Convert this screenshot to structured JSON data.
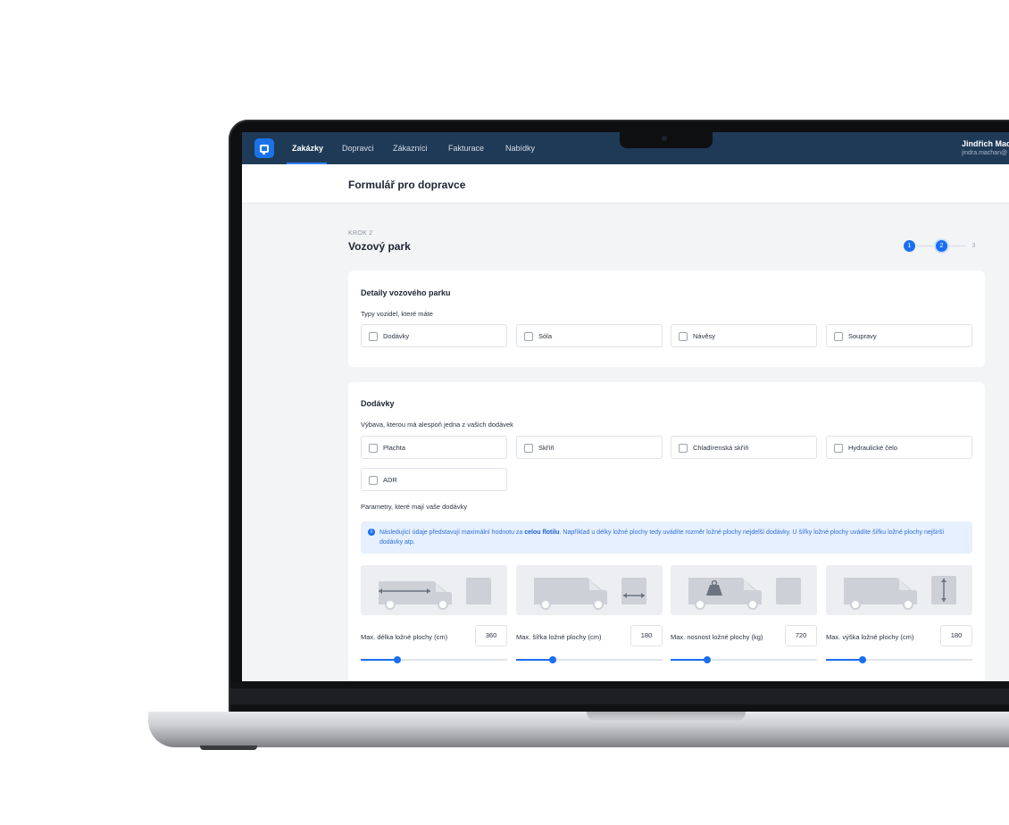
{
  "nav": {
    "items": [
      {
        "label": "Zakázky",
        "active": true
      },
      {
        "label": "Dopravci"
      },
      {
        "label": "Zákazníci"
      },
      {
        "label": "Fakturace"
      },
      {
        "label": "Nabídky"
      }
    ]
  },
  "user": {
    "name": "Jindřich Mach",
    "email": "jindra.machan@"
  },
  "page": {
    "title": "Formulář pro dopravce"
  },
  "step": {
    "kicker": "KROK 2",
    "title": "Vozový park",
    "steps": [
      "1",
      "2",
      "3"
    ],
    "current": 2
  },
  "fleet": {
    "title": "Detaily vozového parku",
    "types_label": "Typy vozidel, které máte",
    "types": [
      "Dodávky",
      "Sóla",
      "Návěsy",
      "Soupravy"
    ]
  },
  "vans": {
    "title": "Dodávky",
    "equipment_label": "Výbava, kterou má alespoň jedna z vašich dodávek",
    "equipment": [
      "Plachta",
      "Skříň",
      "Chladírenská skříň",
      "Hydraulické čelo",
      "ADR"
    ],
    "params_label": "Parametry, které mají vaše dodávky",
    "info_before": "Následující údaje představují maximální hodnotu za ",
    "info_bold": "celou flotilu",
    "info_after": ". Například u délky ložné plochy tedy uvádíte rozměr ložné plochy nejdelší dodávky. U šířky ložné plochy uvádíte šířku ložné plochy nejširší dodávky atp.",
    "params": [
      {
        "label": "Max. délka ložné plochy (cm)",
        "value": "360",
        "slider": 0.25,
        "icon": "length-arrow-icon"
      },
      {
        "label": "Max. šířka ložné plochy (cm)",
        "value": "180",
        "slider": 0.25,
        "icon": "width-arrow-icon"
      },
      {
        "label": "Max. nosnost ložné plochy (kg)",
        "value": "720",
        "slider": 0.25,
        "icon": "weight-icon"
      },
      {
        "label": "Max. výška ložné plochy (cm)",
        "value": "180",
        "slider": 0.25,
        "icon": "height-arrow-icon"
      }
    ]
  },
  "colors": {
    "accent": "#1a6ff0",
    "navbar": "#1f3a57",
    "info_bg": "#e6f0fe"
  }
}
